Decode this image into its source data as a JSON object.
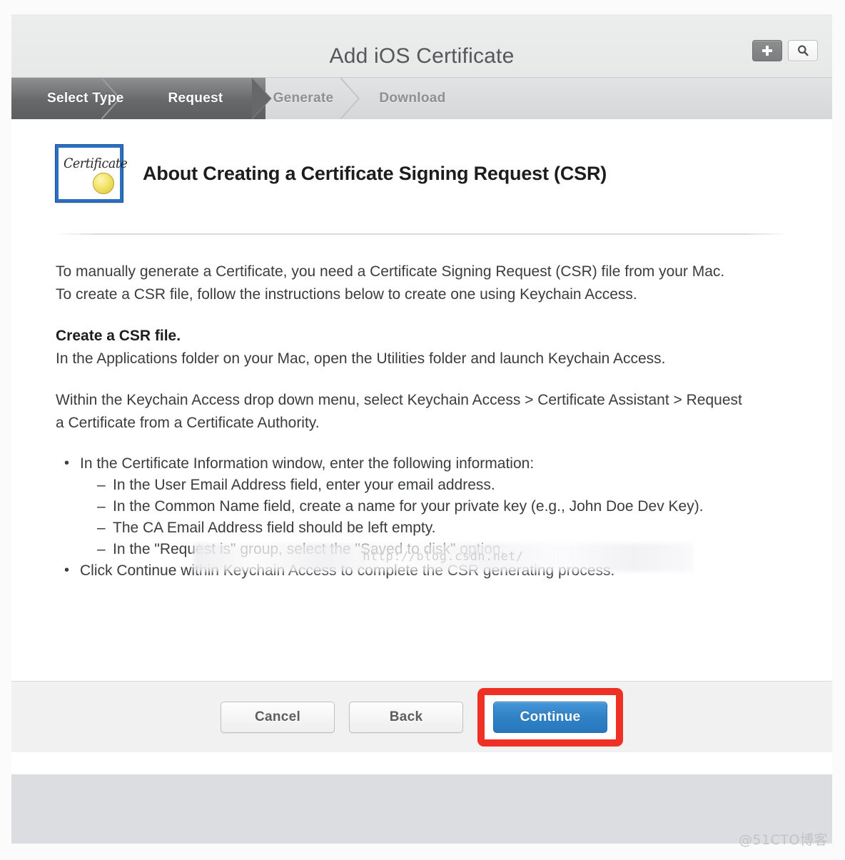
{
  "header": {
    "title": "Add iOS Certificate",
    "add_button_label": "+",
    "add_button_icon": "plus-icon",
    "search_button_icon": "search-icon"
  },
  "steps": [
    {
      "label": "Select Type",
      "state": "active"
    },
    {
      "label": "Request",
      "state": "active"
    },
    {
      "label": "Generate",
      "state": "inactive"
    },
    {
      "label": "Download",
      "state": "inactive"
    }
  ],
  "content": {
    "icon_label": "Certificate",
    "icon_name": "certificate-icon",
    "heading": "About Creating a Certificate Signing Request (CSR)",
    "intro_paragraph": "To manually generate a Certificate, you need a Certificate Signing Request (CSR) file from your Mac. To create a CSR file, follow the instructions below to create one using Keychain Access.",
    "create_heading": "Create a CSR file.",
    "create_paragraph": "In the Applications folder on your Mac, open the Utilities folder and launch Keychain Access.",
    "menu_paragraph": "Within the Keychain Access drop down menu, select Keychain Access > Certificate Assistant > Request a Certificate from a Certificate Authority.",
    "bullets": [
      {
        "text": "In the Certificate Information window, enter the following information:",
        "subitems": [
          "In the User Email Address field, enter your email address.",
          "In the Common Name field, create a name for your private key (e.g., John Doe Dev Key).",
          "The CA Email Address field should be left empty.",
          "In the \"Request is\" group, select the \"Saved to disk\" option."
        ]
      },
      {
        "text": "Click Continue within Keychain Access to complete the CSR generating process.",
        "subitems": []
      }
    ]
  },
  "footer": {
    "cancel_label": "Cancel",
    "back_label": "Back",
    "continue_label": "Continue"
  },
  "watermarks": {
    "inline": "http://blog.csdn.net/",
    "corner": "@51CTO博客"
  },
  "colors": {
    "primary_button": "#2f82c6",
    "highlight_box": "#ee3124",
    "step_active_bg": "#66686a",
    "certificate_border": "#2a6fc4",
    "certificate_seal": "#f3e469"
  }
}
